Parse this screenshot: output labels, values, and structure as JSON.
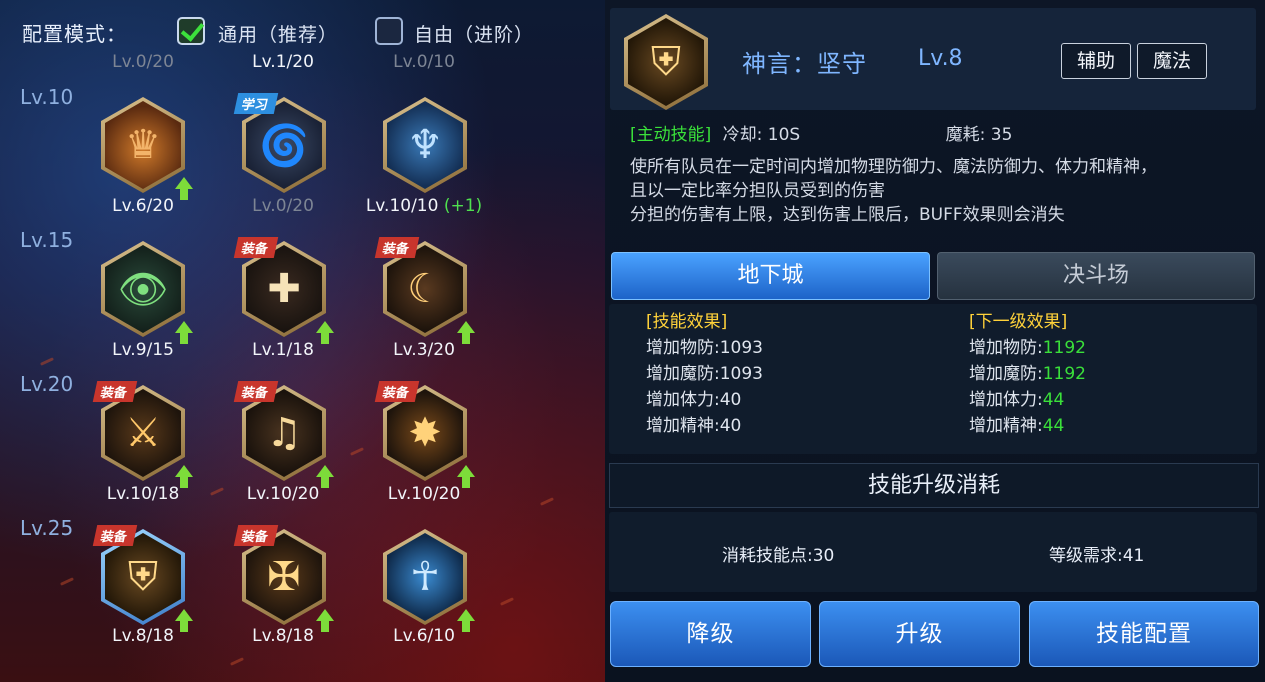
{
  "config": {
    "label": "配置模式：",
    "option_general": "通用（推荐）",
    "option_free": "自由（进阶）"
  },
  "top_levels": [
    "Lv.0/20",
    "Lv.1/20",
    "Lv.0/10"
  ],
  "rows": [
    {
      "tier": "Lv.10",
      "skills": [
        {
          "label": "Lv.6/20",
          "tag": "",
          "icon": "crown-icon",
          "upgradable": true
        },
        {
          "label": "Lv.0/20",
          "tag": "学习",
          "icon": "dancer-icon",
          "upgradable": false
        },
        {
          "label": "Lv.10/10",
          "extra": "(+1)",
          "tag": "",
          "icon": "angel-icon",
          "upgradable": false
        }
      ]
    },
    {
      "tier": "Lv.15",
      "skills": [
        {
          "label": "Lv.9/15",
          "tag": "",
          "icon": "eye-figure-icon",
          "upgradable": true
        },
        {
          "label": "Lv.1/18",
          "tag": "装备",
          "icon": "sparkle-cross-icon",
          "upgradable": true
        },
        {
          "label": "Lv.3/20",
          "tag": "装备",
          "icon": "crescent-icon",
          "upgradable": true
        }
      ]
    },
    {
      "tier": "Lv.20",
      "skills": [
        {
          "label": "Lv.10/18",
          "tag": "装备",
          "icon": "warrior-icon",
          "upgradable": true
        },
        {
          "label": "Lv.10/20",
          "tag": "装备",
          "icon": "music-icon",
          "upgradable": true
        },
        {
          "label": "Lv.10/20",
          "tag": "装备",
          "icon": "burst-icon",
          "upgradable": true
        }
      ]
    },
    {
      "tier": "Lv.25",
      "skills": [
        {
          "label": "Lv.8/18",
          "tag": "装备",
          "icon": "shield-icon",
          "upgradable": true,
          "selected": true
        },
        {
          "label": "Lv.8/18",
          "tag": "装备",
          "icon": "holy-cross-icon",
          "upgradable": true
        },
        {
          "label": "Lv.6/10",
          "tag": "",
          "icon": "spirit-icon",
          "upgradable": true
        }
      ]
    }
  ],
  "detail": {
    "name": "神言：坚守",
    "level": "Lv.8",
    "tag1": "辅助",
    "tag2": "魔法",
    "type": "[主动技能]",
    "cooldown": "冷却: 10S",
    "mana": "魔耗: 35",
    "desc1": "使所有队员在一定时间内增加物理防御力、魔法防御力、体力和精神，",
    "desc2": "且以一定比率分担队员受到的伤害",
    "desc3": "分担的伤害有上限，达到伤害上限后，BUFF效果则会消失"
  },
  "tabs": {
    "dungeon": "地下城",
    "arena": "决斗场"
  },
  "effects": {
    "current_title": "[技能效果]",
    "next_title": "[下一级效果]",
    "rows": [
      {
        "name": "增加物防:",
        "cur": "1093",
        "next": "1192"
      },
      {
        "name": "增加魔防:",
        "cur": "1093",
        "next": "1192"
      },
      {
        "name": "增加体力:",
        "cur": "40",
        "next": "44"
      },
      {
        "name": "增加精神:",
        "cur": "40",
        "next": "44"
      }
    ]
  },
  "cost": {
    "title": "技能升级消耗",
    "points": "消耗技能点:30",
    "level_req": "等级需求:41"
  },
  "buttons": {
    "downgrade": "降级",
    "upgrade": "升级",
    "config": "技能配置"
  }
}
